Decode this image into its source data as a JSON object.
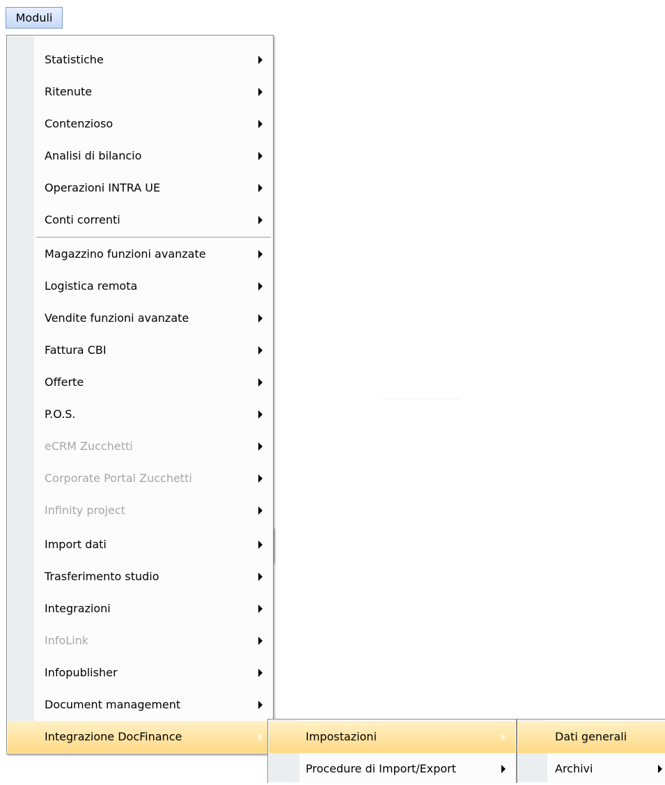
{
  "menubar": {
    "title": "Moduli"
  },
  "main_menu": {
    "items": [
      {
        "text": "Statistiche",
        "disabled": false
      },
      {
        "text": "Ritenute",
        "disabled": false
      },
      {
        "text": "Contenzioso",
        "disabled": false
      },
      {
        "text": "Analisi di bilancio",
        "disabled": false
      },
      {
        "text": "Operazioni INTRA UE",
        "disabled": false
      },
      {
        "text": "Conti correnti",
        "disabled": false
      },
      {
        "text": "Magazzino funzioni avanzate",
        "disabled": false
      },
      {
        "text": "Logistica remota",
        "disabled": false
      },
      {
        "text": "Vendite funzioni avanzate",
        "disabled": false
      },
      {
        "text": "Fattura CBI",
        "disabled": false
      },
      {
        "text": "Offerte",
        "disabled": false
      },
      {
        "text": "P.O.S.",
        "disabled": false
      },
      {
        "text": "eCRM Zucchetti",
        "disabled": true
      },
      {
        "text": "Corporate Portal Zucchetti",
        "disabled": true
      },
      {
        "text": "Infinity project",
        "disabled": true
      },
      {
        "text": "Import dati",
        "disabled": false
      },
      {
        "text": "Trasferimento studio",
        "disabled": false
      },
      {
        "text": "Integrazioni",
        "disabled": false
      },
      {
        "text": "InfoLink",
        "disabled": true
      },
      {
        "text": "Infopublisher",
        "disabled": false
      },
      {
        "text": "Document management",
        "disabled": false
      },
      {
        "text": "Integrazione DocFinance",
        "disabled": false,
        "active": true
      }
    ]
  },
  "submenu_docfinance": {
    "items": [
      {
        "text": "Impostazioni",
        "active": true
      },
      {
        "text": "Procedure di Import/Export"
      }
    ]
  },
  "submenu_impostazioni": {
    "items": [
      {
        "text": "Dati generali",
        "active": true
      },
      {
        "text": "Archivi"
      }
    ]
  }
}
